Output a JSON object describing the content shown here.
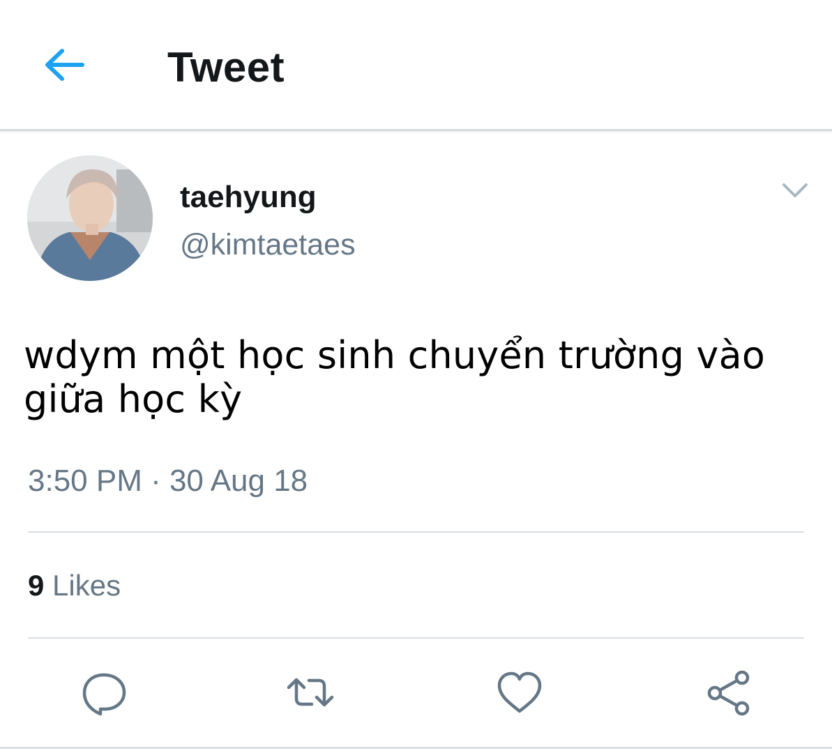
{
  "header": {
    "title": "Tweet",
    "back_icon": "arrow-left-icon",
    "accent_color": "#1da1f2"
  },
  "tweet": {
    "author": {
      "display_name": "taehyung",
      "handle": "@kimtaetaes",
      "avatar_icon": "user-avatar"
    },
    "menu_icon": "chevron-down-icon",
    "text": "wdym một học sinh chuyển trường vào\ngiữa học kỳ",
    "timestamp": "3:50 PM · 30 Aug 18",
    "likes_count": "9",
    "likes_label": " Likes"
  },
  "actions": [
    {
      "name": "reply",
      "icon": "speech-bubble-icon"
    },
    {
      "name": "retweet",
      "icon": "retweet-icon"
    },
    {
      "name": "like",
      "icon": "heart-icon"
    },
    {
      "name": "share",
      "icon": "share-icon"
    }
  ],
  "colors": {
    "text_primary": "#14171a",
    "text_secondary": "#657786",
    "icon_gray": "#657786",
    "divider": "#d9dee2"
  }
}
